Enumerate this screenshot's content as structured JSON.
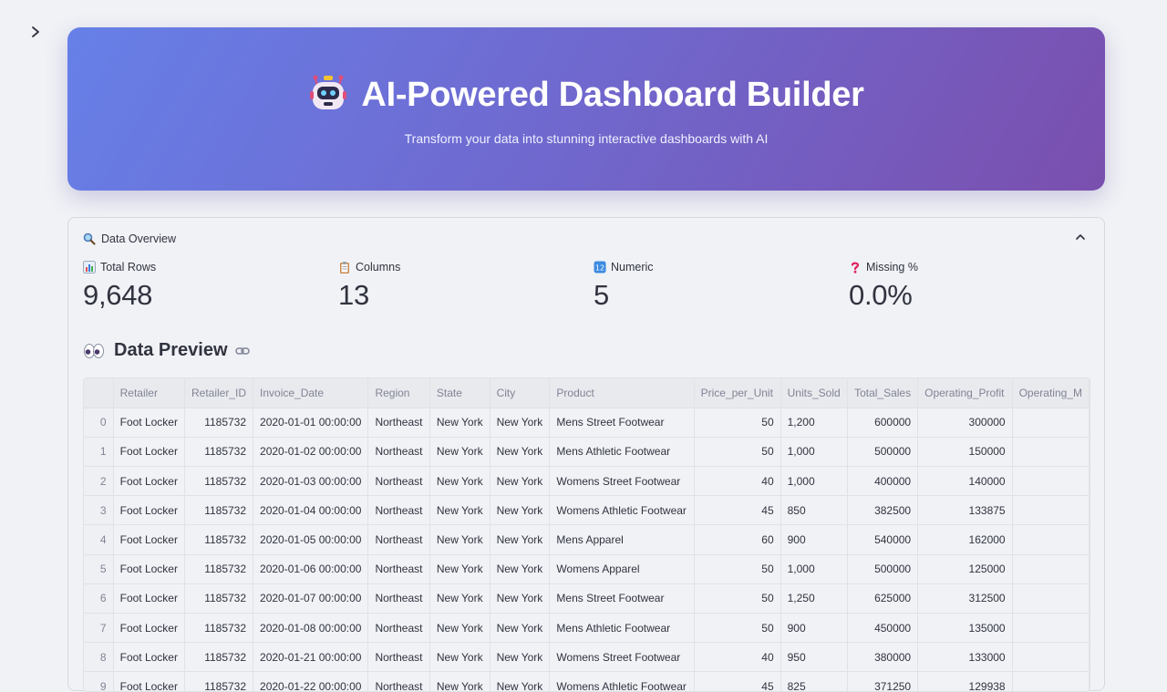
{
  "hero": {
    "title": "AI-Powered Dashboard Builder",
    "subtitle": "Transform your data into stunning interactive dashboards with AI",
    "icon": "robot-emoji"
  },
  "overview": {
    "title": "Data Overview",
    "icon": "magnifier-emoji",
    "metrics": [
      {
        "label": "Total Rows",
        "value": "9,648",
        "icon": "bar-chart-emoji"
      },
      {
        "label": "Columns",
        "value": "13",
        "icon": "clipboard-emoji"
      },
      {
        "label": "Numeric",
        "value": "5",
        "icon": "numbers-emoji"
      },
      {
        "label": "Missing %",
        "value": "0.0%",
        "icon": "question-emoji"
      }
    ]
  },
  "preview": {
    "title": "Data Preview",
    "icon": "eyes-emoji",
    "columns": [
      "",
      "Retailer",
      "Retailer_ID",
      "Invoice_Date",
      "Region",
      "State",
      "City",
      "Product",
      "Price_per_Unit",
      "Units_Sold",
      "Total_Sales",
      "Operating_Profit",
      "Operating_M"
    ],
    "rows": [
      [
        "0",
        "Foot Locker",
        "1185732",
        "2020-01-01 00:00:00",
        "Northeast",
        "New York",
        "New York",
        "Mens Street Footwear",
        "50",
        "1,200",
        "600000",
        "300000",
        ""
      ],
      [
        "1",
        "Foot Locker",
        "1185732",
        "2020-01-02 00:00:00",
        "Northeast",
        "New York",
        "New York",
        "Mens Athletic Footwear",
        "50",
        "1,000",
        "500000",
        "150000",
        ""
      ],
      [
        "2",
        "Foot Locker",
        "1185732",
        "2020-01-03 00:00:00",
        "Northeast",
        "New York",
        "New York",
        "Womens Street Footwear",
        "40",
        "1,000",
        "400000",
        "140000",
        ""
      ],
      [
        "3",
        "Foot Locker",
        "1185732",
        "2020-01-04 00:00:00",
        "Northeast",
        "New York",
        "New York",
        "Womens Athletic Footwear",
        "45",
        "850",
        "382500",
        "133875",
        ""
      ],
      [
        "4",
        "Foot Locker",
        "1185732",
        "2020-01-05 00:00:00",
        "Northeast",
        "New York",
        "New York",
        "Mens Apparel",
        "60",
        "900",
        "540000",
        "162000",
        ""
      ],
      [
        "5",
        "Foot Locker",
        "1185732",
        "2020-01-06 00:00:00",
        "Northeast",
        "New York",
        "New York",
        "Womens Apparel",
        "50",
        "1,000",
        "500000",
        "125000",
        ""
      ],
      [
        "6",
        "Foot Locker",
        "1185732",
        "2020-01-07 00:00:00",
        "Northeast",
        "New York",
        "New York",
        "Mens Street Footwear",
        "50",
        "1,250",
        "625000",
        "312500",
        ""
      ],
      [
        "7",
        "Foot Locker",
        "1185732",
        "2020-01-08 00:00:00",
        "Northeast",
        "New York",
        "New York",
        "Mens Athletic Footwear",
        "50",
        "900",
        "450000",
        "135000",
        ""
      ],
      [
        "8",
        "Foot Locker",
        "1185732",
        "2020-01-21 00:00:00",
        "Northeast",
        "New York",
        "New York",
        "Womens Street Footwear",
        "40",
        "950",
        "380000",
        "133000",
        ""
      ],
      [
        "9",
        "Foot Locker",
        "1185732",
        "2020-01-22 00:00:00",
        "Northeast",
        "New York",
        "New York",
        "Womens Athletic Footwear",
        "45",
        "825",
        "371250",
        "129938",
        ""
      ]
    ]
  }
}
